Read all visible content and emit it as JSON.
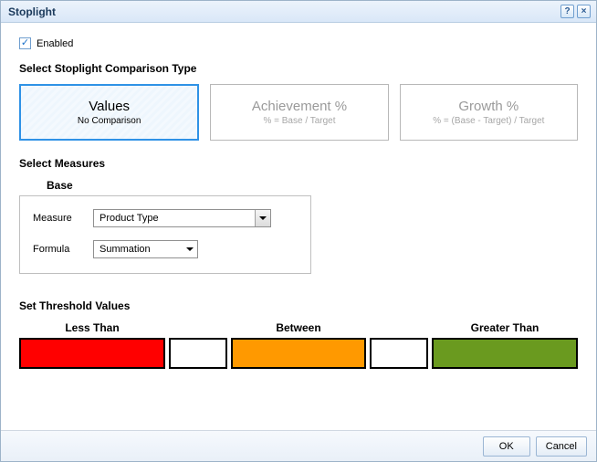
{
  "window": {
    "title": "Stoplight"
  },
  "enabled": {
    "label": "Enabled",
    "checked": true
  },
  "sections": {
    "comparison_type": "Select Stoplight Comparison Type",
    "measures": "Select Measures",
    "thresholds": "Set Threshold Values"
  },
  "type_cards": {
    "values": {
      "title": "Values",
      "subtitle": "No Comparison",
      "selected": true
    },
    "achievement": {
      "title": "Achievement %",
      "subtitle": "% = Base / Target",
      "selected": false
    },
    "growth": {
      "title": "Growth %",
      "subtitle": "% = (Base - Target) / Target",
      "selected": false
    }
  },
  "base": {
    "title": "Base",
    "measure_label": "Measure",
    "measure_value": "Product Type",
    "formula_label": "Formula",
    "formula_value": "Summation"
  },
  "thresholds": {
    "less_label": "Less Than",
    "between_label": "Between",
    "greater_label": "Greater Than",
    "low_value": "",
    "high_value": "",
    "colors": {
      "less": "#ff0000",
      "between": "#ff9900",
      "greater": "#6a9a1f"
    }
  },
  "buttons": {
    "ok": "OK",
    "cancel": "Cancel"
  }
}
